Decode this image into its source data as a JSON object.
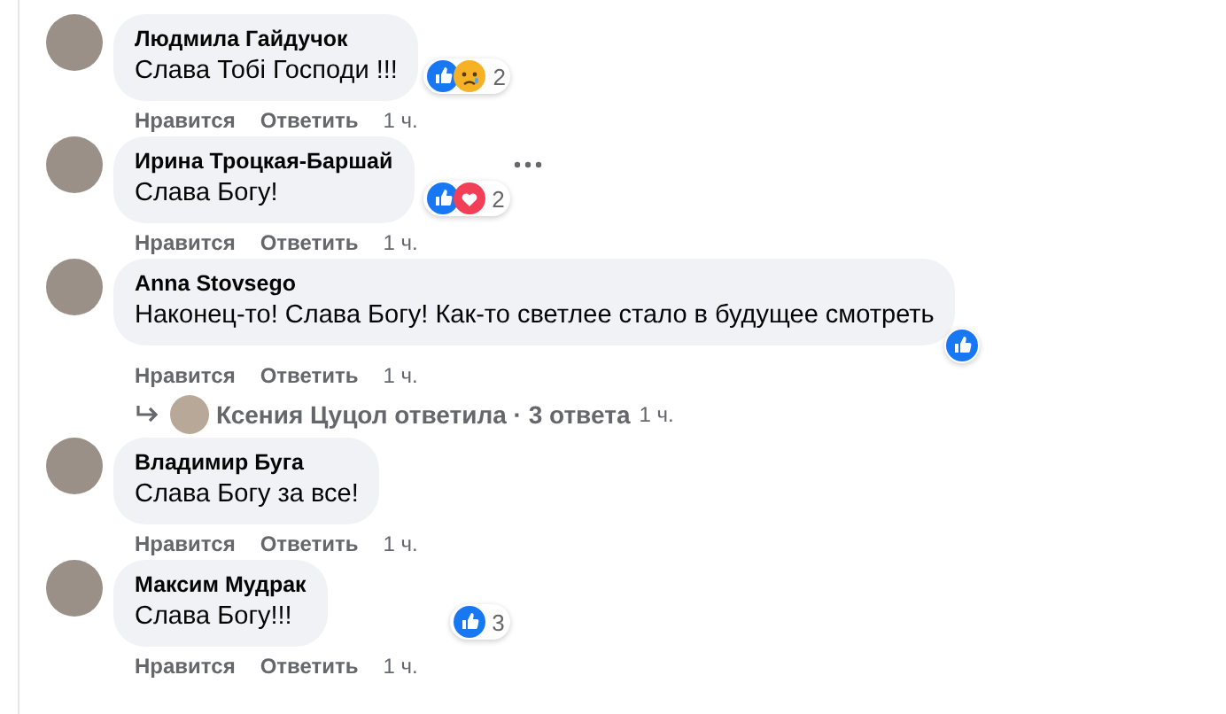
{
  "comments": [
    {
      "author": "Людмила Гайдучок",
      "text": "Слава Тобі Господи !!!",
      "reactions": {
        "icons": [
          {
            "kind": "like"
          },
          {
            "kind": "sad"
          }
        ],
        "count": "2"
      },
      "menu": false,
      "actions": {
        "like": "Нравится",
        "reply": "Ответить",
        "time": "1 ч."
      }
    },
    {
      "author": "Ирина Троцкая-Баршай",
      "text": "Слава Богу!",
      "reactions": {
        "icons": [
          {
            "kind": "like"
          },
          {
            "kind": "love"
          }
        ],
        "count": "2"
      },
      "menu": true,
      "actions": {
        "like": "Нравится",
        "reply": "Ответить",
        "time": "1 ч."
      }
    },
    {
      "author": "Anna Stovsego",
      "text": "Наконец-то! Слава Богу! Как-то светлее стало в будущее смотреть",
      "reactions": {
        "icons": [
          {
            "kind": "like"
          }
        ]
      },
      "menu": false,
      "actions": {
        "like": "Нравится",
        "reply": "Ответить",
        "time": "1 ч."
      },
      "replies": {
        "summary": "Ксения Цуцол ответила · 3 ответа",
        "time": "1 ч."
      }
    },
    {
      "author": "Владимир Буга",
      "text": "Слава Богу за все!",
      "menu": false,
      "actions": {
        "like": "Нравится",
        "reply": "Ответить",
        "time": "1 ч."
      }
    },
    {
      "author": "Максим Мудрак",
      "text": "Слава Богу!!!",
      "reactions": {
        "icons": [
          {
            "kind": "like"
          }
        ],
        "count": "3"
      },
      "menu": false,
      "actions": {
        "like": "Нравится",
        "reply": "Ответить",
        "time": "1 ч."
      }
    }
  ]
}
